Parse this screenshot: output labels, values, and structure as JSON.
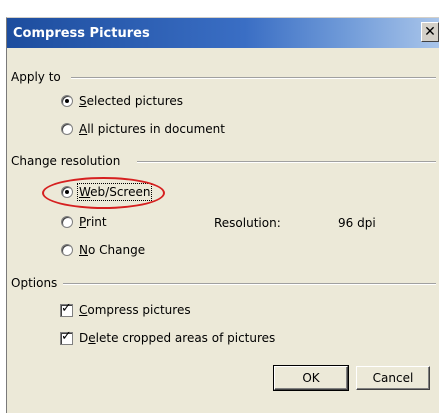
{
  "dialog": {
    "title": "Compress Pictures",
    "close_glyph": "✕"
  },
  "apply_to": {
    "label": "Apply to",
    "options": [
      {
        "pre": "",
        "accel": "S",
        "post": "elected pictures",
        "checked": true
      },
      {
        "pre": "",
        "accel": "A",
        "post": "ll pictures in document",
        "checked": false
      }
    ]
  },
  "change_resolution": {
    "label": "Change resolution",
    "options": [
      {
        "pre": "",
        "accel": "W",
        "post": "eb/Screen",
        "checked": true
      },
      {
        "pre": "",
        "accel": "P",
        "post": "rint",
        "checked": false
      },
      {
        "pre": "",
        "accel": "N",
        "post": "o Change",
        "checked": false
      }
    ],
    "resolution_label": "Resolution:",
    "resolution_value": "96 dpi"
  },
  "options": {
    "label": "Options",
    "items": [
      {
        "pre": "",
        "accel": "C",
        "post": "ompress pictures",
        "checked": true
      },
      {
        "pre": "D",
        "accel": "e",
        "post": "lete cropped areas of pictures",
        "checked": true
      }
    ],
    "check_glyph": "✓"
  },
  "buttons": {
    "ok": "OK",
    "cancel": "Cancel"
  },
  "icons": {
    "close": "close-icon",
    "checkbox_tick": "check-icon"
  },
  "colors": {
    "title_bar_start": "#1d4d9e",
    "dialog_face": "#ece9d8",
    "highlight_ring": "#d62020"
  }
}
